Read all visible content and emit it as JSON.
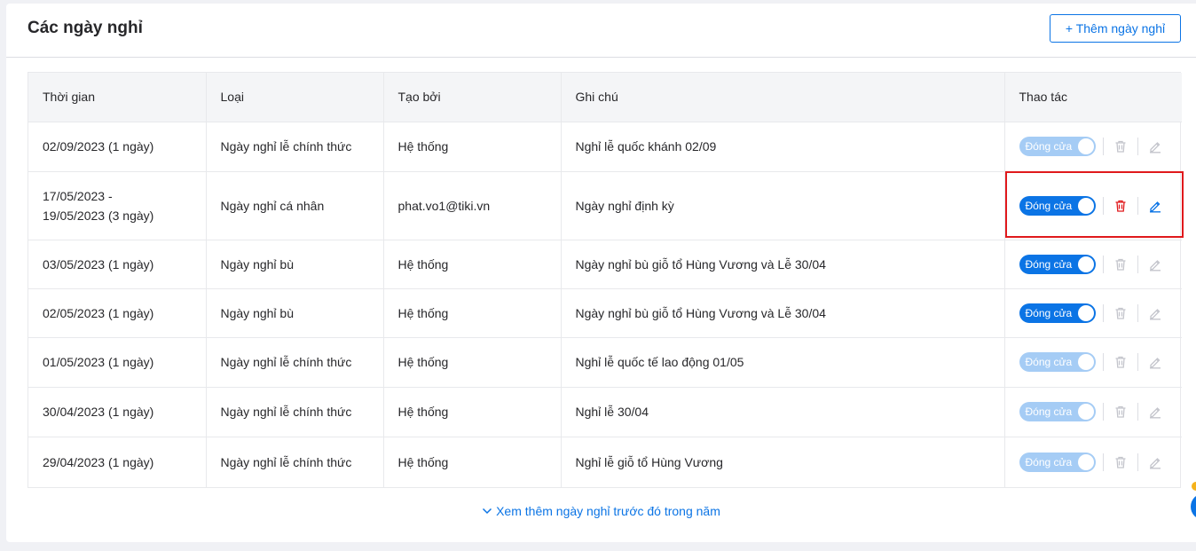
{
  "header": {
    "title": "Các ngày nghỉ",
    "add_button": "+ Thêm ngày nghỉ"
  },
  "table": {
    "columns": [
      "Thời gian",
      "Loại",
      "Tạo bởi",
      "Ghi chú",
      "Thao tác"
    ],
    "rows": [
      {
        "time": "02/09/2023 (1 ngày)",
        "type": "Ngày nghỉ lễ chính thức",
        "created_by": "Hệ thống",
        "note": "Nghỉ lễ quốc khánh 02/09",
        "toggle": "Đóng cửa",
        "enabled": false
      },
      {
        "time": "17/05/2023 - 19/05/2023 (3 ngày)",
        "type": "Ngày nghỉ cá nhân",
        "created_by": "phat.vo1@tiki.vn",
        "note": "Ngày nghỉ định kỳ",
        "toggle": "Đóng cửa",
        "enabled": true
      },
      {
        "time": "03/05/2023 (1 ngày)",
        "type": "Ngày nghỉ bù",
        "created_by": "Hệ thống",
        "note": "Ngày nghỉ bù giỗ tổ Hùng Vương và Lễ 30/04",
        "toggle": "Đóng cửa",
        "enabled": false
      },
      {
        "time": "02/05/2023 (1 ngày)",
        "type": "Ngày nghỉ bù",
        "created_by": "Hệ thống",
        "note": "Ngày nghỉ bù giỗ tổ Hùng Vương và Lễ 30/04",
        "toggle": "Đóng cửa",
        "enabled": false
      },
      {
        "time": "01/05/2023 (1 ngày)",
        "type": "Ngày nghỉ lễ chính thức",
        "created_by": "Hệ thống",
        "note": "Nghỉ lễ quốc tế lao động 01/05",
        "toggle": "Đóng cửa",
        "enabled": false
      },
      {
        "time": "30/04/2023 (1 ngày)",
        "type": "Ngày nghỉ lễ chính thức",
        "created_by": "Hệ thống",
        "note": "Nghỉ lễ 30/04",
        "toggle": "Đóng cửa",
        "enabled": false
      },
      {
        "time": "29/04/2023 (1 ngày)",
        "type": "Ngày nghỉ lễ chính thức",
        "created_by": "Hệ thống",
        "note": "Nghỉ lễ giỗ tổ Hùng Vương",
        "toggle": "Đóng cửa",
        "enabled": false
      }
    ]
  },
  "footer": {
    "more_link": "Xem thêm ngày nghỉ trước đó trong năm"
  },
  "colors": {
    "accent": "#0b74e5",
    "danger": "#e0191c",
    "disabled_toggle": "#a5ccf5",
    "disabled_icon": "#c4c5cc"
  },
  "row_toggle_style": [
    "disabled",
    "active",
    "active",
    "active",
    "disabled",
    "disabled",
    "disabled"
  ],
  "icons": {
    "delete": "trash-icon",
    "edit": "pencil-icon",
    "more": "chevron-down-icon"
  }
}
